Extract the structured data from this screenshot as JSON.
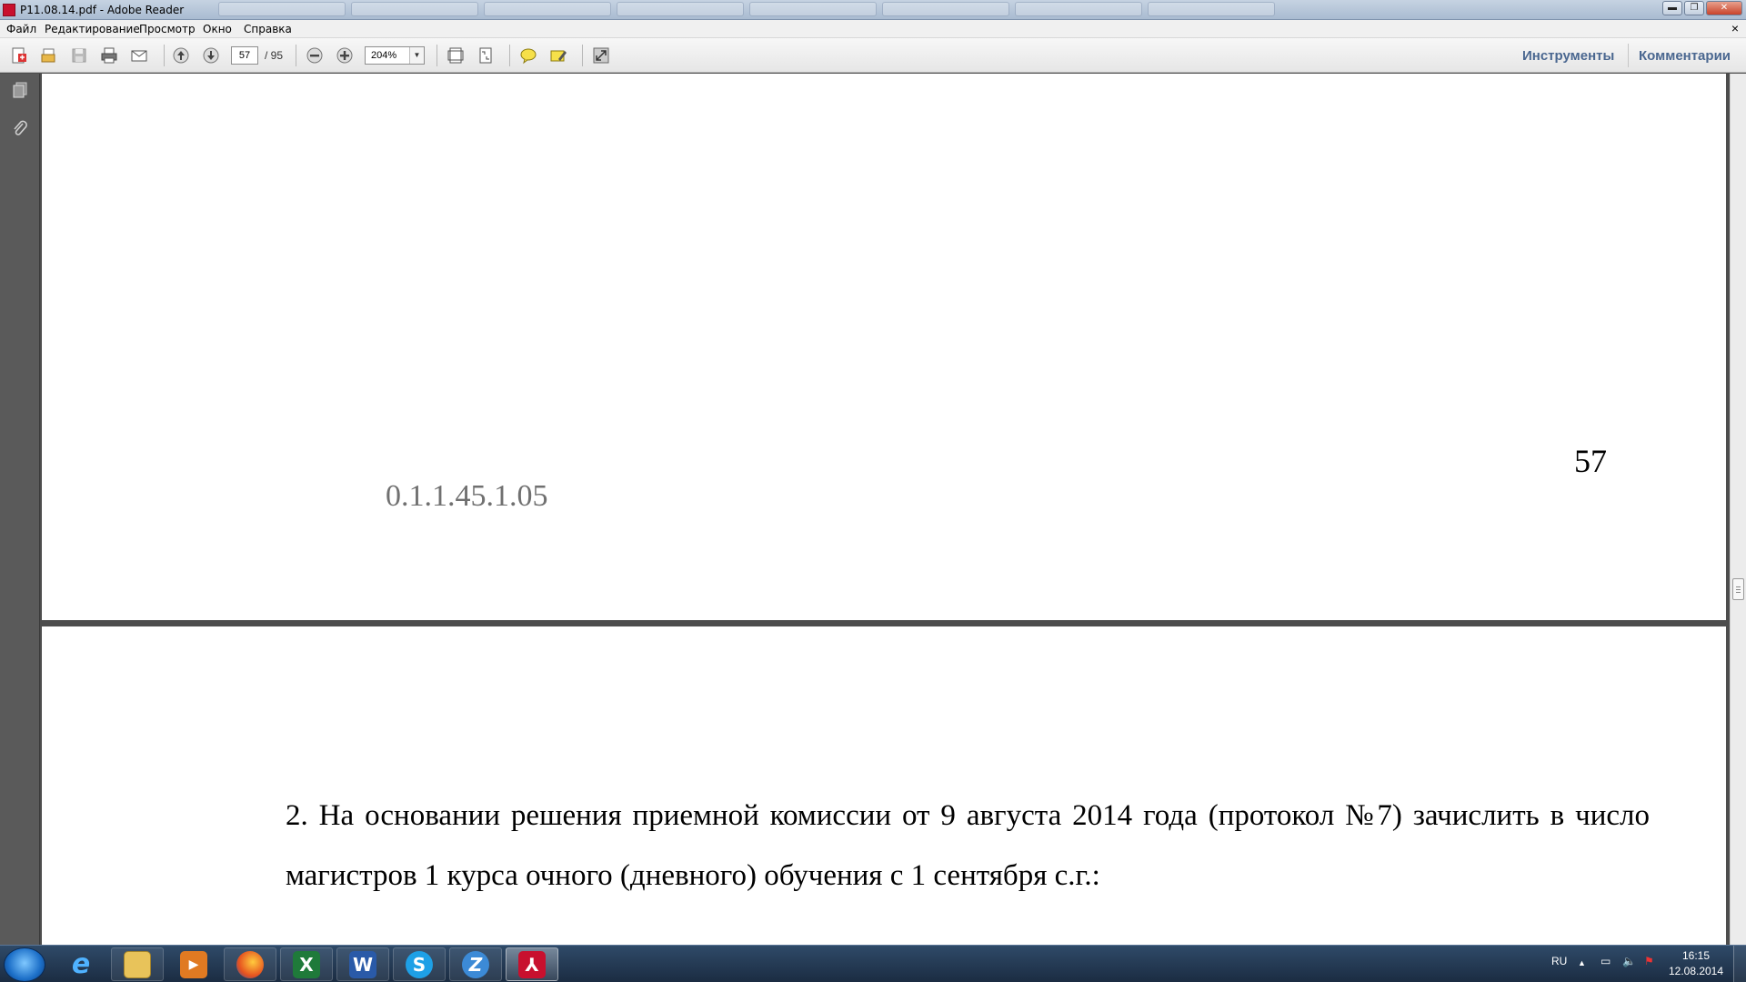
{
  "window": {
    "title": "P11.08.14.pdf - Adobe Reader",
    "buttons": {
      "minimize": "▬",
      "maximize": "❐",
      "close": "✕"
    }
  },
  "menu": {
    "items": [
      "Файл",
      "Редактирование",
      "Просмотр",
      "Окно",
      "Справка"
    ],
    "close_doc": "×"
  },
  "toolbar": {
    "current_page": "57",
    "page_total": "/ 95",
    "zoom": "204%",
    "zoom_arrow": "▼",
    "tools_label": "Инструменты",
    "comments_label": "Комментарии"
  },
  "document": {
    "page1": {
      "page_number": "57",
      "code": "0.1.1.45.1.05"
    },
    "page2": {
      "paragraph": "2. На основании решения приемной комиссии от 9 августа 2014 года (протокол №7) зачислить в число магистров 1 курса очного (дневного) обучения с 1 сентября с.г.:"
    }
  },
  "taskbar": {
    "apps": [
      "internet-explorer",
      "file-explorer",
      "media-player",
      "firefox",
      "excel",
      "word",
      "skype",
      "opera",
      "adobe-reader"
    ],
    "language": "RU",
    "tray_up": "▲",
    "time": "16:15",
    "date": "12.08.2014"
  },
  "colors": {
    "panel_link": "#4a6790",
    "doc_background": "#4d4d4d",
    "taskbar": "#1b2c42"
  }
}
